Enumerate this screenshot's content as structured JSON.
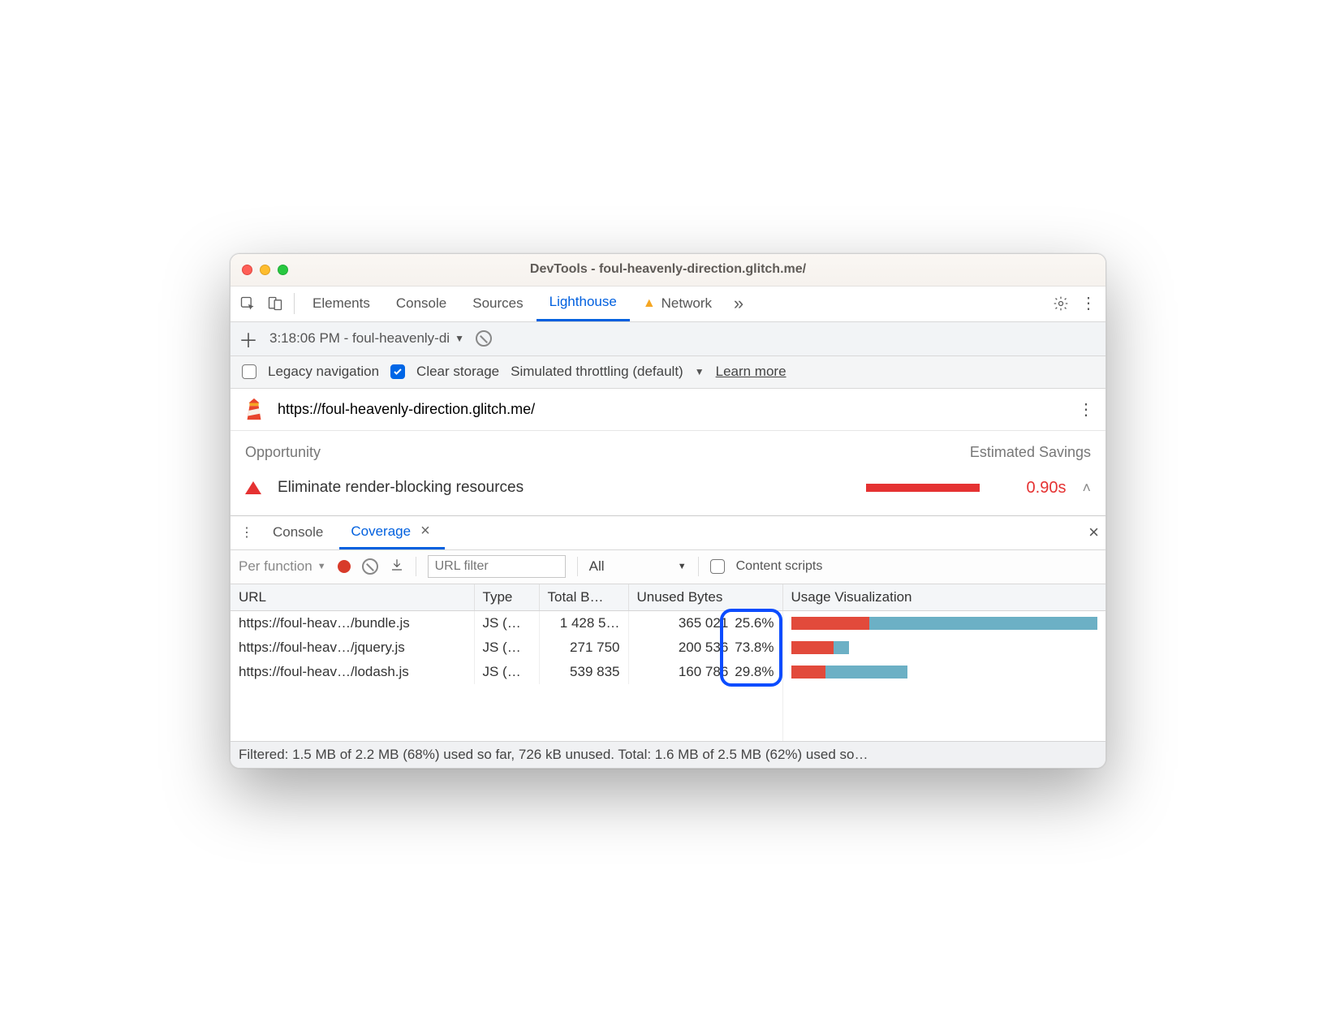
{
  "window": {
    "title": "DevTools - foul-heavenly-direction.glitch.me/"
  },
  "main_tabs": [
    "Elements",
    "Console",
    "Sources",
    "Lighthouse",
    "Network"
  ],
  "main_active": "Lighthouse",
  "subbar": {
    "report_label": "3:18:06 PM - foul-heavenly-di"
  },
  "options": {
    "legacy_label": "Legacy navigation",
    "clear_label": "Clear storage",
    "throttle_label": "Simulated throttling (default)",
    "learn_more": "Learn more"
  },
  "url_row": {
    "url": "https://foul-heavenly-direction.glitch.me/"
  },
  "opportunity": {
    "header_left": "Opportunity",
    "header_right": "Estimated Savings",
    "title": "Eliminate render-blocking resources",
    "time": "0.90s"
  },
  "drawer_tabs": {
    "console": "Console",
    "coverage": "Coverage"
  },
  "coverage_toolbar": {
    "mode": "Per function",
    "filter_placeholder": "URL filter",
    "type_filter": "All",
    "content_scripts_label": "Content scripts"
  },
  "coverage_table": {
    "headers": {
      "url": "URL",
      "type": "Type",
      "total": "Total B…",
      "unused": "Unused Bytes",
      "viz": "Usage Visualization"
    },
    "rows": [
      {
        "url": "https://foul-heav…/bundle.js",
        "type": "JS (…",
        "total": "1 428 5…",
        "unused_bytes": "365 021",
        "pct": "25.6%",
        "unused_ratio": 0.256,
        "width_ratio": 1.0
      },
      {
        "url": "https://foul-heav…/jquery.js",
        "type": "JS (…",
        "total": "271 750",
        "unused_bytes": "200 536",
        "pct": "73.8%",
        "unused_ratio": 0.738,
        "width_ratio": 0.19
      },
      {
        "url": "https://foul-heav…/lodash.js",
        "type": "JS (…",
        "total": "539 835",
        "unused_bytes": "160 786",
        "pct": "29.8%",
        "unused_ratio": 0.298,
        "width_ratio": 0.38
      }
    ],
    "status": "Filtered: 1.5 MB of 2.2 MB (68%) used so far, 726 kB unused. Total: 1.6 MB of 2.5 MB (62%) used so…"
  }
}
